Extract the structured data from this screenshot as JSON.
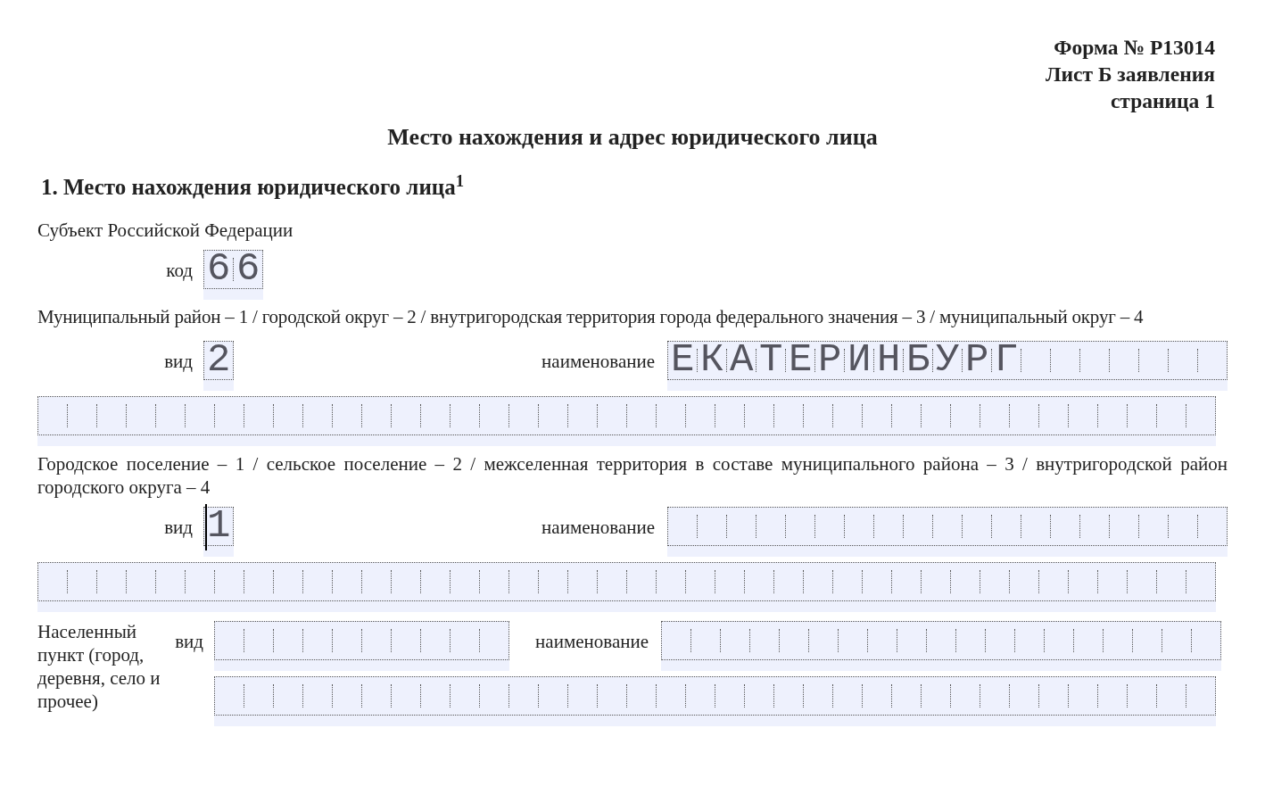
{
  "header_lines": [
    "Форма № Р13014",
    "Лист Б заявления",
    "страница 1"
  ],
  "title": "Место нахождения и адрес юридического лица",
  "section_heading": "1. Место нахождения юридического лица$^{1}$",
  "subject": {
    "label": "Субъект Российской Федерации",
    "code_label": "код",
    "code": {
      "value": "66",
      "focused": false
    }
  },
  "municipality": {
    "description": "Муниципальный район – 1 / городской округ – 2 / внутригородская территория города федерального значения – 3 / муниципальный округ – 4",
    "type_label": "вид",
    "type": {
      "value": "2",
      "focused": false
    },
    "name_label": "наименование",
    "name": {
      "value": "ЕКАТЕРИНБУРГ",
      "focused": false
    },
    "name_continued": {
      "focused": false
    }
  },
  "settlement": {
    "description": "Городское поселение – 1 / сельское поселение – 2 / межселенная территория в составе муниципального района – 3 / внутригородской район городского округа – 4",
    "type_label": "вид",
    "type": {
      "value": "1",
      "focused": true
    },
    "name_label": "наименование",
    "name": {
      "focused": false
    },
    "name_continued": {
      "focused": false
    }
  },
  "locality": {
    "label": "Населенный пункт (город, деревня, село и прочее)",
    "type_label": "вид",
    "type": {
      "focused": false
    },
    "name_label": "наименование",
    "name": {
      "focused": false
    },
    "name_continued": {
      "focused": false
    }
  }
}
